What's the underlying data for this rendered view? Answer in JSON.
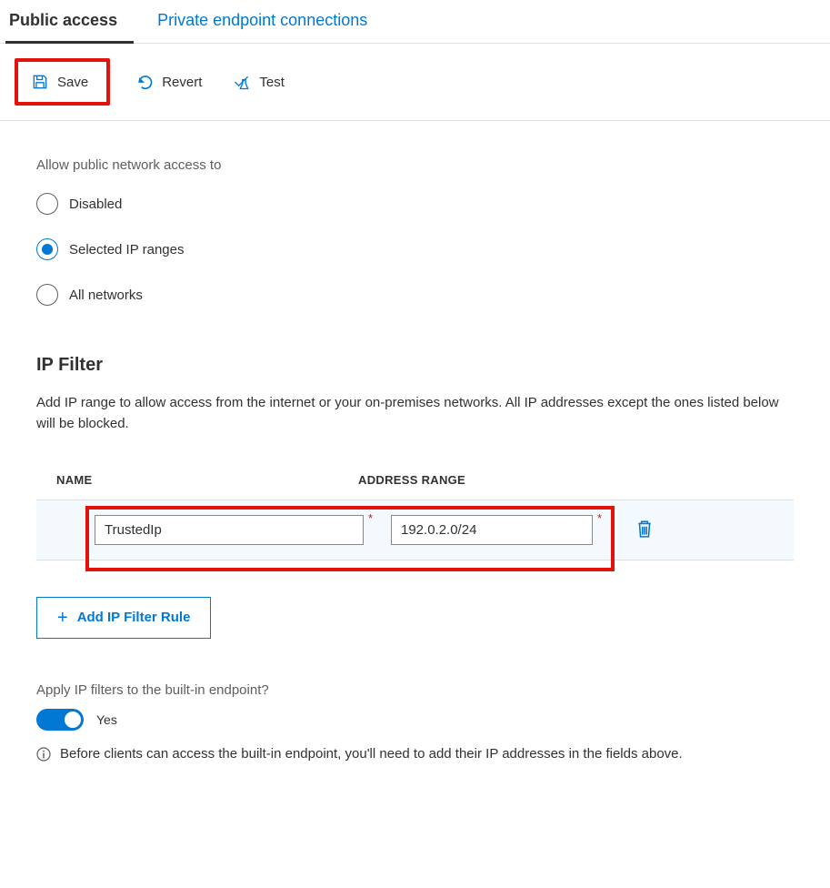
{
  "tabs": {
    "public": "Public access",
    "private": "Private endpoint connections",
    "active": "public"
  },
  "toolbar": {
    "save": "Save",
    "revert": "Revert",
    "test": "Test"
  },
  "access": {
    "label": "Allow public network access to",
    "options": {
      "disabled": "Disabled",
      "selected": "Selected IP ranges",
      "all": "All networks"
    },
    "value": "selected"
  },
  "ipfilter": {
    "title": "IP Filter",
    "description": "Add IP range to allow access from the internet or your on-premises networks. All IP addresses except the ones listed below will be blocked.",
    "columns": {
      "name": "NAME",
      "address": "ADDRESS RANGE"
    },
    "rows": [
      {
        "name": "TrustedIp",
        "address": "192.0.2.0/24"
      }
    ],
    "add_button": "Add IP Filter Rule"
  },
  "builtin": {
    "question": "Apply IP filters to the built-in endpoint?",
    "toggle_value": true,
    "toggle_label": "Yes",
    "info": "Before clients can access the built-in endpoint, you'll need to add their IP addresses in the fields above."
  },
  "colors": {
    "accent": "#0078d4",
    "highlight": "#e3120b"
  }
}
